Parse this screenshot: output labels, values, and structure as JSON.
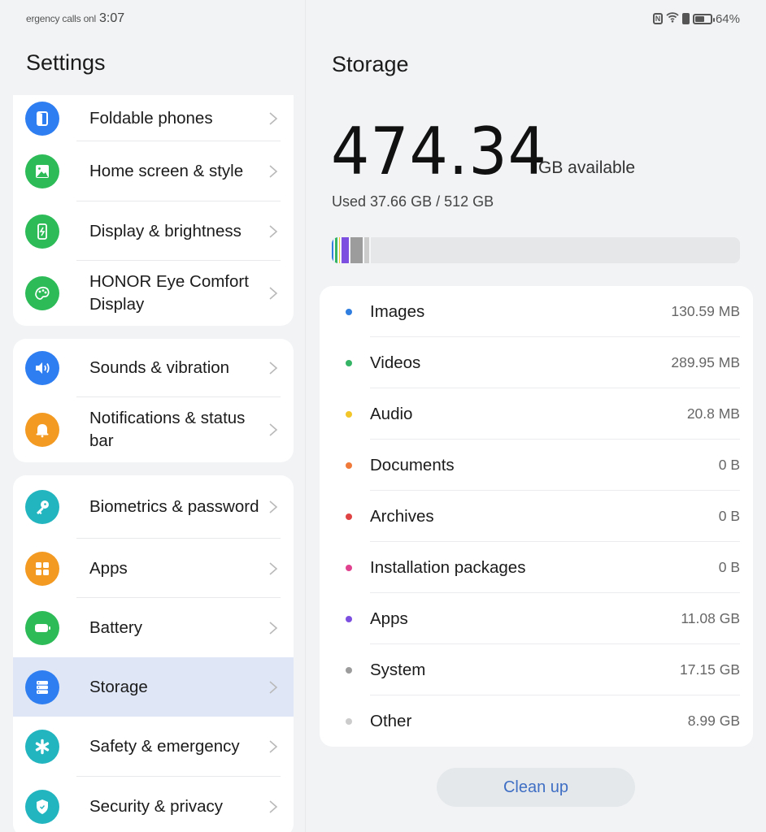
{
  "status_bar": {
    "carrier_text": "ergency calls onl",
    "time": "3:07",
    "icons": [
      "nfc-icon",
      "wifi-icon",
      "sim-icon",
      "battery-icon"
    ],
    "battery_percent": "64%",
    "battery_level": 0.64
  },
  "settings": {
    "title": "Settings",
    "groups": [
      {
        "items": [
          {
            "label": "Foldable phones",
            "icon": "foldable-phone-icon",
            "color": "#2f7ef1"
          },
          {
            "label": "Home screen & style",
            "icon": "image-icon",
            "color": "#2dbb58"
          },
          {
            "label": "Display & brightness",
            "icon": "display-brightness-icon",
            "color": "#2dbb58"
          },
          {
            "label": "HONOR Eye Comfort Display",
            "icon": "eye-comfort-icon",
            "color": "#2dbb58"
          }
        ]
      },
      {
        "items": [
          {
            "label": "Sounds & vibration",
            "icon": "speaker-icon",
            "color": "#2f7ef1"
          },
          {
            "label": "Notifications & status bar",
            "icon": "bell-icon",
            "color": "#f39a22"
          }
        ]
      },
      {
        "items": [
          {
            "label": "Biometrics & password",
            "icon": "key-icon",
            "color": "#22b5c0"
          },
          {
            "label": "Apps",
            "icon": "apps-grid-icon",
            "color": "#f39a22"
          },
          {
            "label": "Battery",
            "icon": "battery-icon",
            "color": "#2dbb58"
          },
          {
            "label": "Storage",
            "icon": "storage-icon",
            "color": "#2f7ef1",
            "selected": true
          },
          {
            "label": "Safety & emergency",
            "icon": "asterisk-icon",
            "color": "#22b5c0"
          },
          {
            "label": "Security & privacy",
            "icon": "shield-icon",
            "color": "#22b5c0"
          }
        ]
      }
    ]
  },
  "storage": {
    "title": "Storage",
    "available_value": "474.34",
    "available_unit": "GB available",
    "used_text": "Used 37.66 GB / 512 GB",
    "used_fraction": 0.0736,
    "bar_segments": [
      {
        "name": "Images",
        "color": "#2f7ee0",
        "fraction": 0.008
      },
      {
        "name": "Videos",
        "color": "#35b466",
        "fraction": 0.01
      },
      {
        "name": "Audio",
        "color": "#f2c529",
        "fraction": 0.006
      },
      {
        "name": "Apps",
        "color": "#7d4fe0",
        "fraction": 0.022
      },
      {
        "name": "System",
        "color": "#9c9c9c",
        "fraction": 0.033
      },
      {
        "name": "Other",
        "color": "#cccccc",
        "fraction": 0.017
      }
    ],
    "categories": [
      {
        "name": "Images",
        "size": "130.59 MB",
        "color": "#2f7ee0"
      },
      {
        "name": "Videos",
        "size": "289.95 MB",
        "color": "#35b466"
      },
      {
        "name": "Audio",
        "size": "20.8 MB",
        "color": "#f2c529"
      },
      {
        "name": "Documents",
        "size": "0 B",
        "color": "#ef7a3a"
      },
      {
        "name": "Archives",
        "size": "0 B",
        "color": "#e04343"
      },
      {
        "name": "Installation packages",
        "size": "0 B",
        "color": "#e0428f"
      },
      {
        "name": "Apps",
        "size": "11.08 GB",
        "color": "#7d4fe0"
      },
      {
        "name": "System",
        "size": "17.15 GB",
        "color": "#9c9c9c"
      },
      {
        "name": "Other",
        "size": "8.99 GB",
        "color": "#cccccc"
      }
    ],
    "cleanup_label": "Clean up"
  }
}
